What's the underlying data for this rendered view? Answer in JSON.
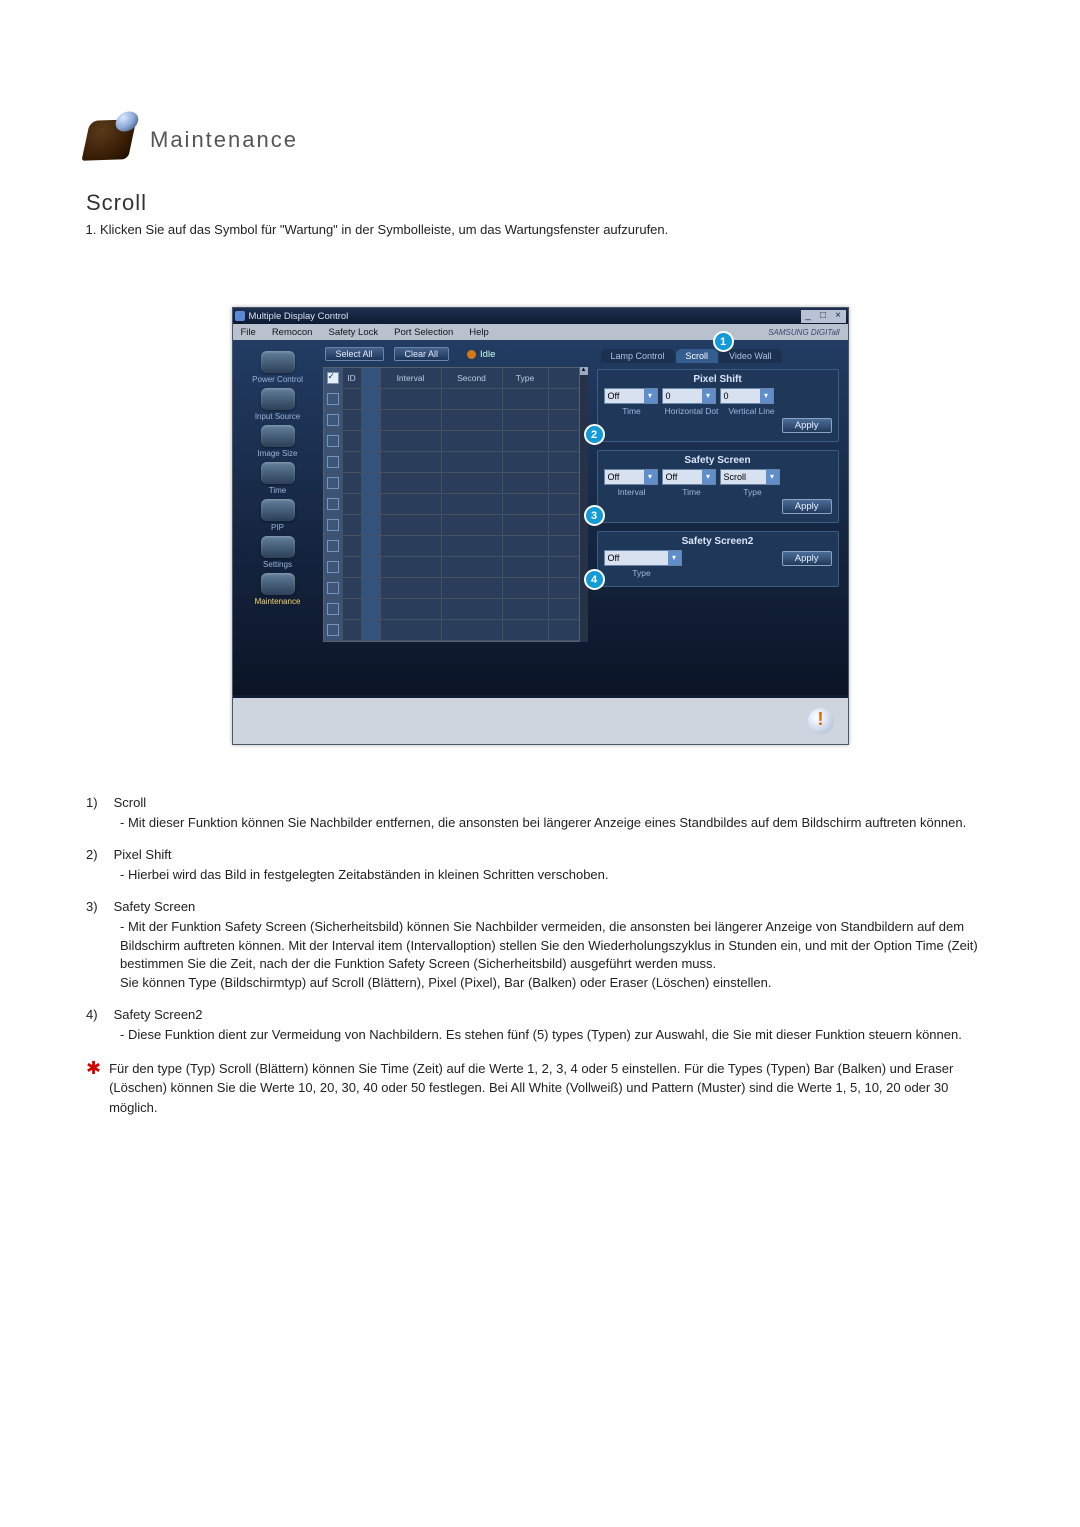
{
  "header": {
    "title": "Maintenance"
  },
  "section": {
    "title": "Scroll"
  },
  "intro": {
    "item1": "Klicken Sie auf das Symbol für \"Wartung\" in der Symbolleiste, um das Wartungsfenster aufzurufen."
  },
  "win": {
    "title": "Multiple Display Control",
    "minimize": "_",
    "maximize": "□",
    "close": "×",
    "menu": {
      "file": "File",
      "remocon": "Remocon",
      "safety": "Safety Lock",
      "port": "Port Selection",
      "help": "Help",
      "brand": "SAMSUNG DIGITall"
    },
    "sidebar": {
      "items": [
        {
          "label": "Power Control"
        },
        {
          "label": "Input Source"
        },
        {
          "label": "Image Size"
        },
        {
          "label": "Time"
        },
        {
          "label": "PIP"
        },
        {
          "label": "Settings"
        },
        {
          "label": "Maintenance"
        }
      ]
    },
    "toolbar": {
      "select_all": "Select All",
      "clear_all": "Clear All",
      "idle": "Idle"
    },
    "grid": {
      "cols": {
        "chk": "",
        "id": "ID",
        "ico": "",
        "interval": "Interval",
        "second": "Second",
        "type": "Type"
      }
    },
    "right": {
      "tabs": {
        "lamp": "Lamp Control",
        "scroll": "Scroll",
        "video": "Video Wall"
      },
      "marker1": "1",
      "pixel_shift": {
        "title": "Pixel Shift",
        "time_val": "Off",
        "hdot_val": "0",
        "vline_val": "0",
        "time_lbl": "Time",
        "hdot_lbl": "Horizontal Dot",
        "vline_lbl": "Vertical Line",
        "apply": "Apply",
        "marker": "2"
      },
      "safety_screen": {
        "title": "Safety Screen",
        "interval_val": "Off",
        "time_val": "Off",
        "type_val": "Scroll",
        "interval_lbl": "Interval",
        "time_lbl": "Time",
        "type_lbl": "Type",
        "apply": "Apply",
        "marker": "3"
      },
      "safety_screen2": {
        "title": "Safety Screen2",
        "type_val": "Off",
        "type_lbl": "Type",
        "apply": "Apply",
        "marker": "4"
      }
    },
    "status_icon": "!"
  },
  "desc": {
    "items": [
      {
        "num": "1)",
        "title": "Scroll",
        "body": "- Mit dieser Funktion können Sie Nachbilder entfernen, die ansonsten bei längerer Anzeige eines Standbildes auf dem Bildschirm auftreten können."
      },
      {
        "num": "2)",
        "title": "Pixel Shift",
        "body": "- Hierbei wird das Bild in festgelegten Zeitabständen in kleinen Schritten verschoben."
      },
      {
        "num": "3)",
        "title": "Safety Screen",
        "body": "- Mit der Funktion Safety Screen (Sicherheitsbild) können Sie Nachbilder vermeiden, die ansonsten bei längerer Anzeige von Standbildern auf dem Bildschirm auftreten können.  Mit der Interval item (Intervalloption) stellen Sie den Wiederholungszyklus in Stunden ein, und mit der Option Time (Zeit) bestimmen Sie die Zeit, nach der die Funktion Safety Screen (Sicherheitsbild) ausgeführt werden muss.\nSie können Type (Bildschirmtyp) auf Scroll (Blättern), Pixel (Pixel), Bar (Balken) oder Eraser (Löschen) einstellen."
      },
      {
        "num": "4)",
        "title": "Safety Screen2",
        "body": "- Diese Funktion dient zur Vermeidung von Nachbildern. Es stehen fünf (5) types (Typen) zur Auswahl, die Sie mit dieser Funktion steuern können."
      }
    ],
    "star": "Für den type (Typ) Scroll (Blättern) können Sie Time (Zeit) auf die Werte 1, 2, 3, 4 oder 5 einstellen. Für die Types (Typen) Bar (Balken) und Eraser (Löschen) können Sie die Werte 10, 20, 30, 40 oder 50 festlegen. Bei All White (Vollweiß) und Pattern (Muster) sind die Werte 1, 5, 10, 20 oder 30 möglich."
  }
}
